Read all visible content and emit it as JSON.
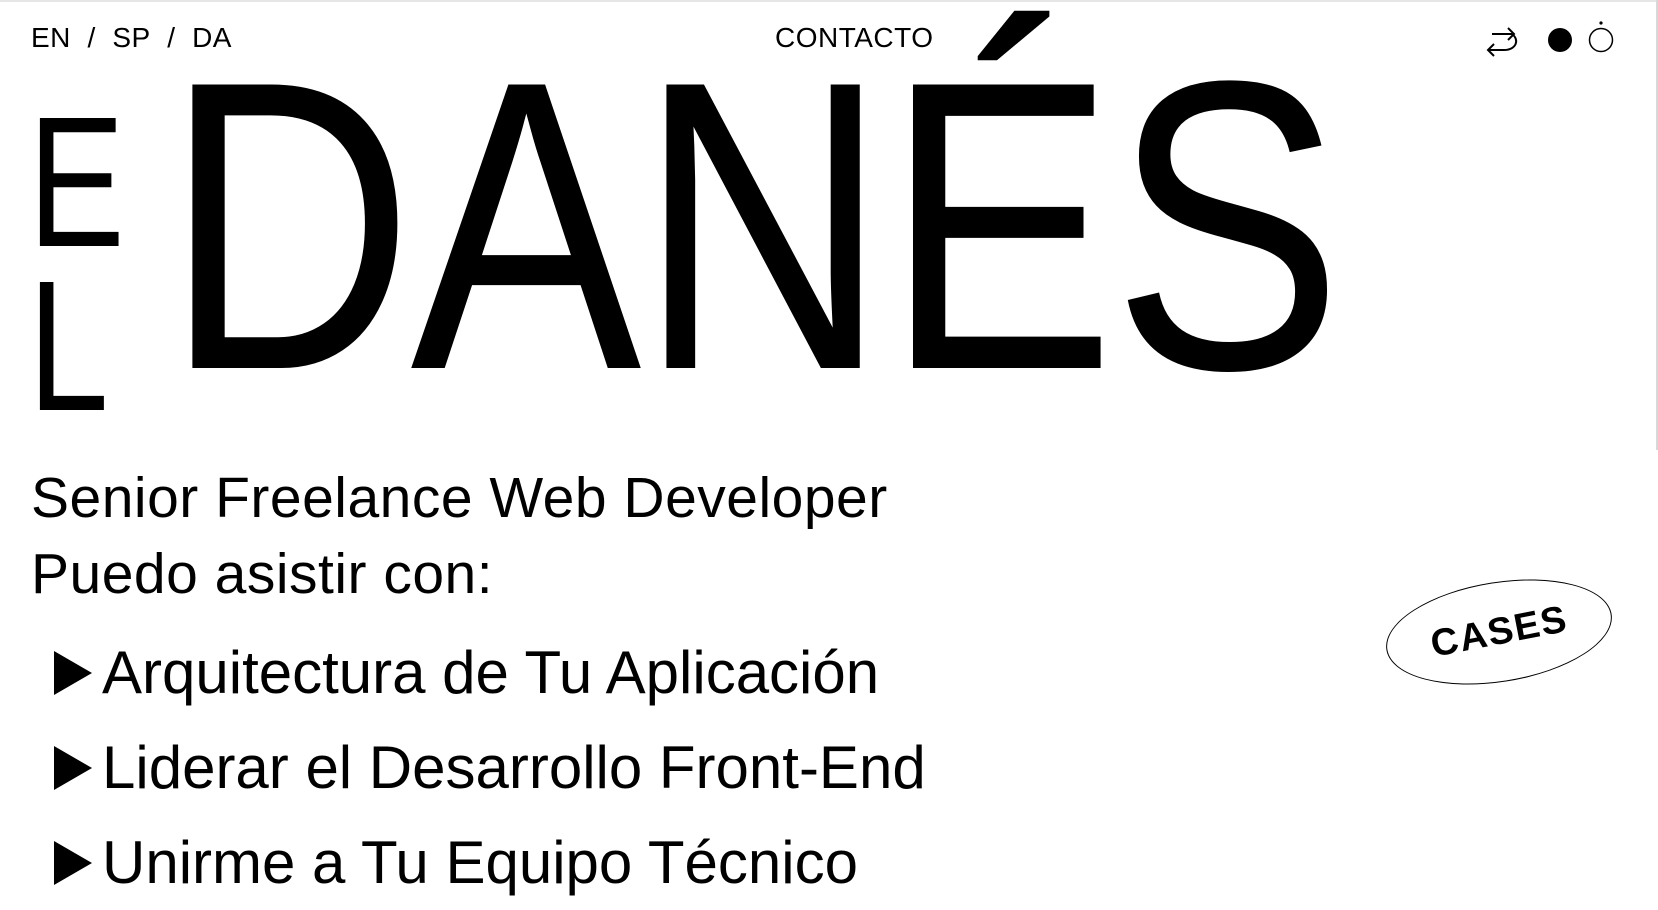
{
  "header": {
    "languages": [
      "EN",
      "SP",
      "DA"
    ],
    "separator": "/",
    "contact_label": "CONTACTO",
    "icons": [
      "return-arrow-icon",
      "dark-mode-dot-icon",
      "light-mode-dot-icon"
    ]
  },
  "hero": {
    "side_letters": [
      "E",
      "L"
    ],
    "title": "DANÉS"
  },
  "intro": {
    "line1": "Senior Freelance Web Developer",
    "line2": "Puedo asistir con:"
  },
  "services": [
    "Arquitectura de Tu Aplicación",
    "Liderar el Desarrollo Front-End",
    "Unirme a Tu Equipo Técnico"
  ],
  "cases_label": "CASES",
  "colors": {
    "background": "#ffffff",
    "text": "#000000"
  }
}
